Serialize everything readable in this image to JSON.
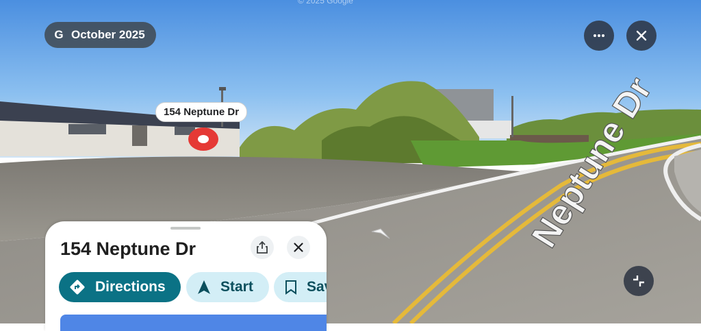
{
  "watermark": "© 2025 Google",
  "date_badge": {
    "logo": "G",
    "text": "October 2025"
  },
  "top_controls": {
    "more_icon": "more-horizontal-icon",
    "close_icon": "close-icon"
  },
  "place_label": "154 Neptune Dr",
  "road_marking": "Neptune Dr",
  "place_card": {
    "title": "154 Neptune Dr",
    "share_icon": "share-icon",
    "close_icon": "close-icon",
    "actions": [
      {
        "label": "Directions",
        "icon": "directions-icon"
      },
      {
        "label": "Start",
        "icon": "navigation-arrow-icon"
      },
      {
        "label": "Save",
        "icon": "bookmark-icon"
      }
    ]
  },
  "colors": {
    "primary_chip": "#0b7285",
    "secondary_chip": "#d3eef6",
    "pin_red": "#e53935"
  }
}
